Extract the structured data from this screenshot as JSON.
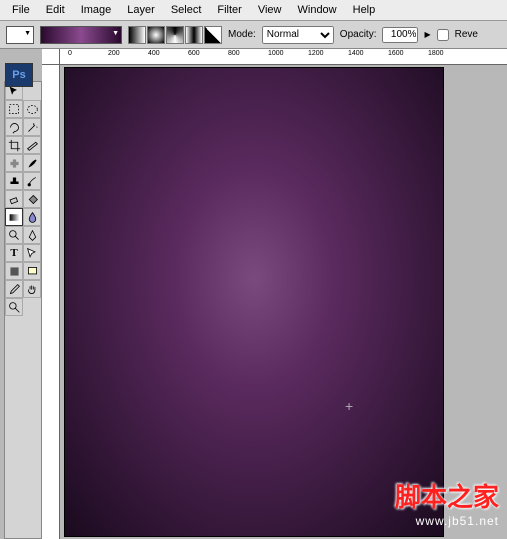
{
  "menu": [
    "File",
    "Edit",
    "Image",
    "Layer",
    "Select",
    "Filter",
    "View",
    "Window",
    "Help"
  ],
  "opt": {
    "mode_label": "Mode:",
    "mode_value": "Normal",
    "opacity_label": "Opacity:",
    "opacity_value": "100%",
    "reverse_label": "Reve"
  },
  "badge": "Ps",
  "ruler_marks": [
    "0",
    "200",
    "400",
    "600",
    "800",
    "1000",
    "1200",
    "1400",
    "1600",
    "1800"
  ],
  "watermark": {
    "text": "脚本之家",
    "url": "www.jb51.net"
  },
  "colors": {
    "canvas_center": "#7a4a7e",
    "canvas_edge": "#1a0a1e"
  }
}
